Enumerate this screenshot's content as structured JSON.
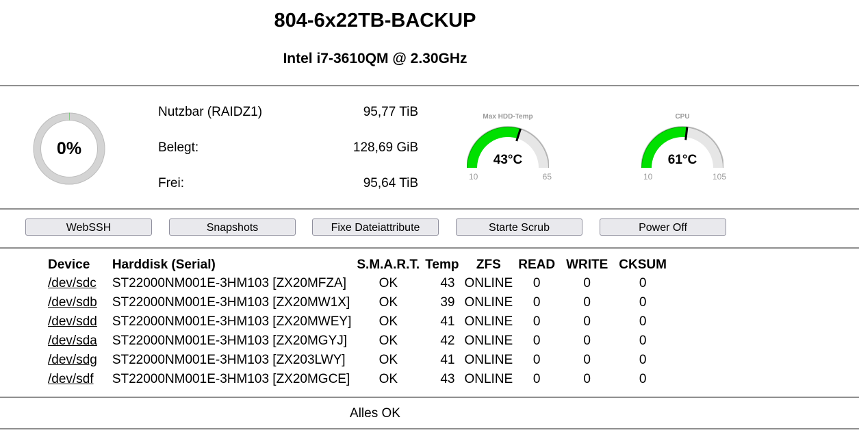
{
  "header": {
    "title": "804-6x22TB-BACKUP",
    "cpu": "Intel i7-3610QM @ 2.30GHz"
  },
  "storage": {
    "usage_percent_label": "0%",
    "usage_fraction": 0.0013,
    "rows": [
      {
        "label": "Nutzbar (RAIDZ1)",
        "value": "95,77 TiB"
      },
      {
        "label": "Belegt:",
        "value": "128,69 GiB"
      },
      {
        "label": "Frei:",
        "value": "95,64 TiB"
      }
    ]
  },
  "gauges": [
    {
      "label": "Max HDD-Temp",
      "value_label": "43°C",
      "value": 43,
      "min": 10,
      "max": 65,
      "min_label": "10",
      "max_label": "65"
    },
    {
      "label": "CPU",
      "value_label": "61°C",
      "value": 61,
      "min": 10,
      "max": 105,
      "min_label": "10",
      "max_label": "105"
    }
  ],
  "colors": {
    "gauge_fill": "#00e000",
    "gauge_track": "#e6e6e6",
    "ring": "#cfcfcf",
    "divider": "#8f8f8f"
  },
  "buttons": [
    {
      "label": "WebSSH"
    },
    {
      "label": "Snapshots"
    },
    {
      "label": "Fixe Dateiattribute"
    },
    {
      "label": "Starte Scrub"
    },
    {
      "label": "Power Off"
    }
  ],
  "table": {
    "headers": [
      "Device",
      "Harddisk (Serial)",
      "S.M.A.R.T.",
      "Temp",
      "ZFS",
      "READ",
      "WRITE",
      "CKSUM"
    ],
    "rows": [
      [
        "/dev/sdc",
        "ST22000NM001E-3HM103 [ZX20MFZA]",
        "OK",
        "43",
        "ONLINE",
        "0",
        "0",
        "0"
      ],
      [
        "/dev/sdb",
        "ST22000NM001E-3HM103 [ZX20MW1X]",
        "OK",
        "39",
        "ONLINE",
        "0",
        "0",
        "0"
      ],
      [
        "/dev/sdd",
        "ST22000NM001E-3HM103 [ZX20MWEY]",
        "OK",
        "41",
        "ONLINE",
        "0",
        "0",
        "0"
      ],
      [
        "/dev/sda",
        "ST22000NM001E-3HM103 [ZX20MGYJ]",
        "OK",
        "42",
        "ONLINE",
        "0",
        "0",
        "0"
      ],
      [
        "/dev/sdg",
        "ST22000NM001E-3HM103 [ZX203LWY]",
        "OK",
        "41",
        "ONLINE",
        "0",
        "0",
        "0"
      ],
      [
        "/dev/sdf",
        "ST22000NM001E-3HM103 [ZX20MGCE]",
        "OK",
        "43",
        "ONLINE",
        "0",
        "0",
        "0"
      ]
    ]
  },
  "status": {
    "text": "Alles OK"
  }
}
